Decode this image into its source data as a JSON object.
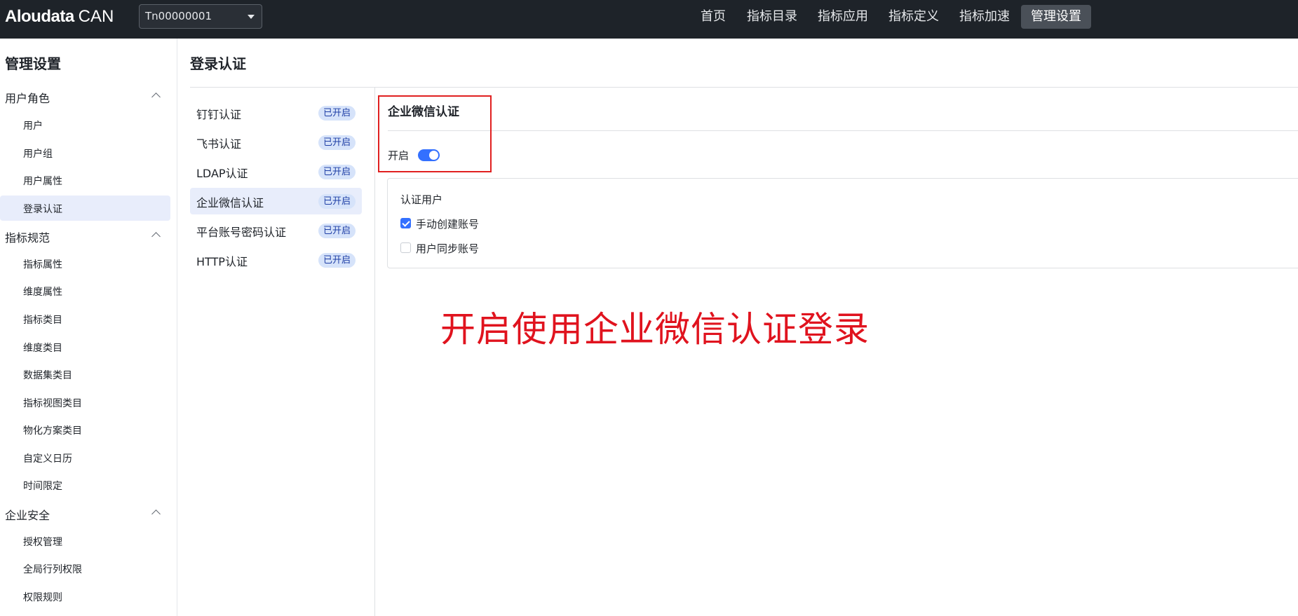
{
  "app": {
    "brand": "Aloudata",
    "product": "CAN"
  },
  "tenant": {
    "selected": "Tn00000001"
  },
  "nav": [
    {
      "label": "首页",
      "active": false
    },
    {
      "label": "指标目录",
      "active": false
    },
    {
      "label": "指标应用",
      "active": false
    },
    {
      "label": "指标定义",
      "active": false
    },
    {
      "label": "指标加速",
      "active": false
    },
    {
      "label": "管理设置",
      "active": true
    }
  ],
  "sidebar": {
    "title": "管理设置",
    "groups": [
      {
        "label": "用户角色",
        "items": [
          "用户",
          "用户组",
          "用户属性",
          "登录认证"
        ]
      },
      {
        "label": "指标规范",
        "items": [
          "指标属性",
          "维度属性",
          "指标类目",
          "维度类目",
          "数据集类目",
          "指标视图类目",
          "物化方案类目",
          "自定义日历",
          "时间限定"
        ]
      },
      {
        "label": "企业安全",
        "items": [
          "授权管理",
          "全局行列权限",
          "权限规则"
        ]
      }
    ],
    "active_item": "登录认证"
  },
  "page": {
    "title": "登录认证"
  },
  "auth_methods": [
    {
      "label": "钉钉认证",
      "status": "已开启"
    },
    {
      "label": "飞书认证",
      "status": "已开启"
    },
    {
      "label": "LDAP认证",
      "status": "已开启"
    },
    {
      "label": "企业微信认证",
      "status": "已开启"
    },
    {
      "label": "平台账号密码认证",
      "status": "已开启"
    },
    {
      "label": "HTTP认证",
      "status": "已开启"
    }
  ],
  "detail": {
    "title": "企业微信认证",
    "toggle_label": "开启",
    "toggle_on": true,
    "card_title": "认证用户",
    "options": [
      {
        "label": "手动创建账号",
        "checked": true
      },
      {
        "label": "用户同步账号",
        "checked": false
      }
    ]
  },
  "annotation": "开启使用企业微信认证登录",
  "colors": {
    "accent": "#3370ff",
    "annotation": "#e0131e",
    "topbar": "#1e2329"
  }
}
